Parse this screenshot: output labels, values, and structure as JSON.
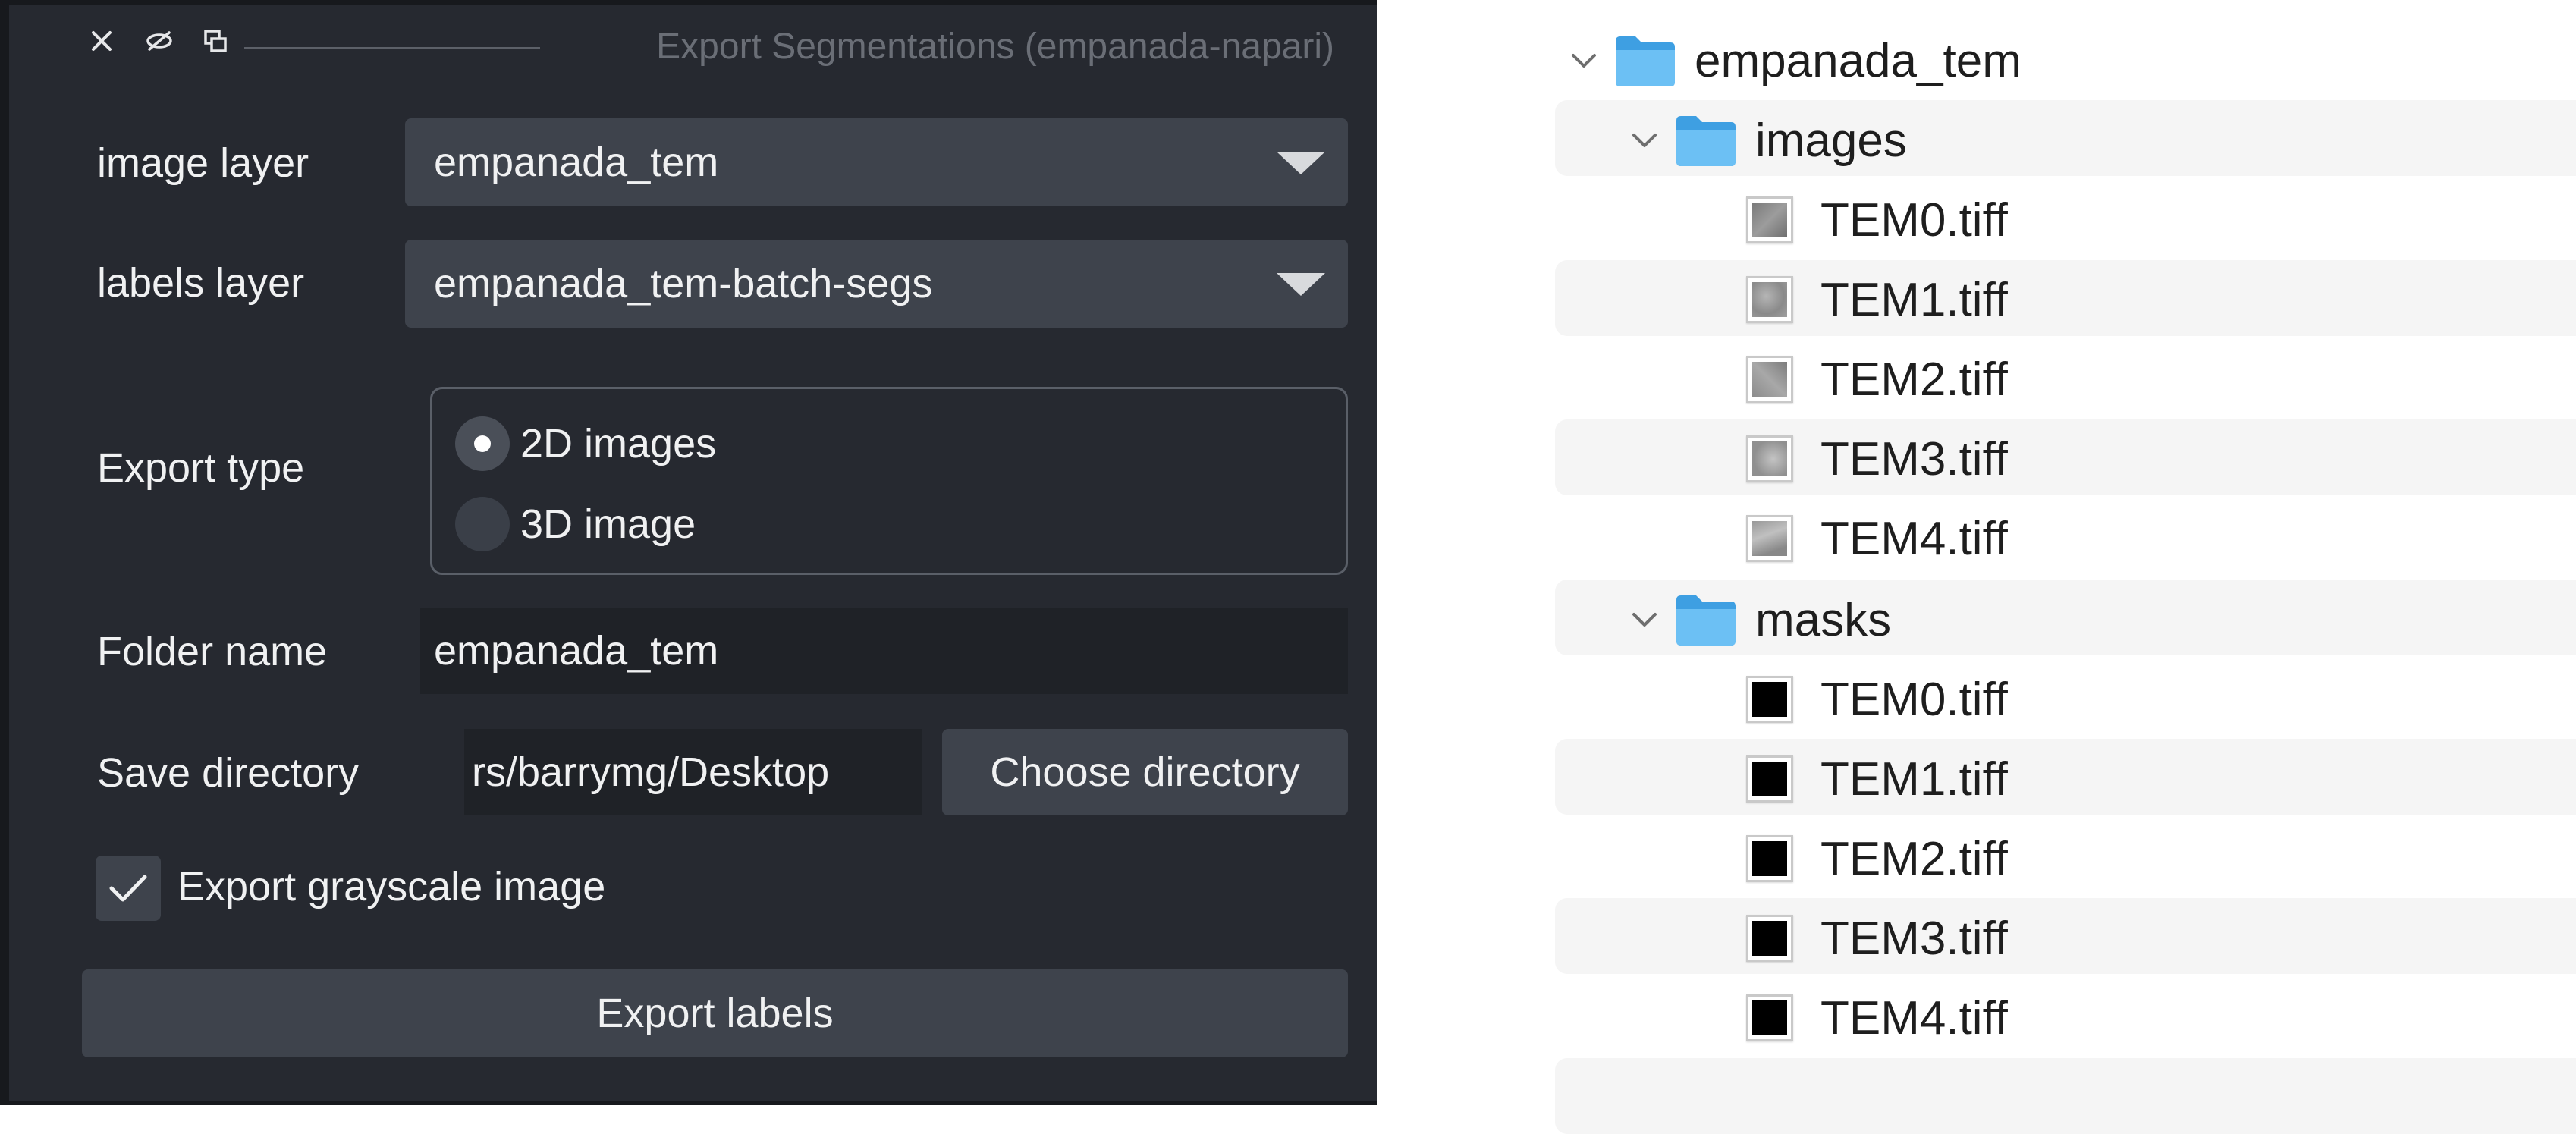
{
  "panel": {
    "title": "Export Segmentations (empanada-napari)",
    "image_layer": {
      "label": "image layer",
      "value": "empanada_tem"
    },
    "labels_layer": {
      "label": "labels layer",
      "value": "empanada_tem-batch-segs"
    },
    "export_type": {
      "label": "Export type",
      "options": [
        {
          "label": "2D images",
          "selected": true
        },
        {
          "label": "3D image",
          "selected": false
        }
      ]
    },
    "folder_name": {
      "label": "Folder name",
      "value": "empanada_tem"
    },
    "save_directory": {
      "label": "Save directory",
      "value": "rs/barrymg/Desktop",
      "button": "Choose directory"
    },
    "grayscale": {
      "label": "Export grayscale image",
      "checked": true
    },
    "export_button": "Export labels"
  },
  "file_tree": {
    "root": "empanada_tem",
    "folders": [
      {
        "name": "images",
        "files": [
          "TEM0.tiff",
          "TEM1.tiff",
          "TEM2.tiff",
          "TEM3.tiff",
          "TEM4.tiff"
        ]
      },
      {
        "name": "masks",
        "files": [
          "TEM0.tiff",
          "TEM1.tiff",
          "TEM2.tiff",
          "TEM3.tiff",
          "TEM4.tiff"
        ]
      }
    ]
  },
  "colors": {
    "panel_bg": "#262930",
    "widget_bg": "#3e434c",
    "folder_blue": "#5bb4ee",
    "stripe": "#f5f5f5"
  },
  "icons": [
    "close-icon",
    "float-icon",
    "hide-icon",
    "chevron-down-icon",
    "folder-icon",
    "check-icon",
    "dropdown-arrow-icon"
  ]
}
